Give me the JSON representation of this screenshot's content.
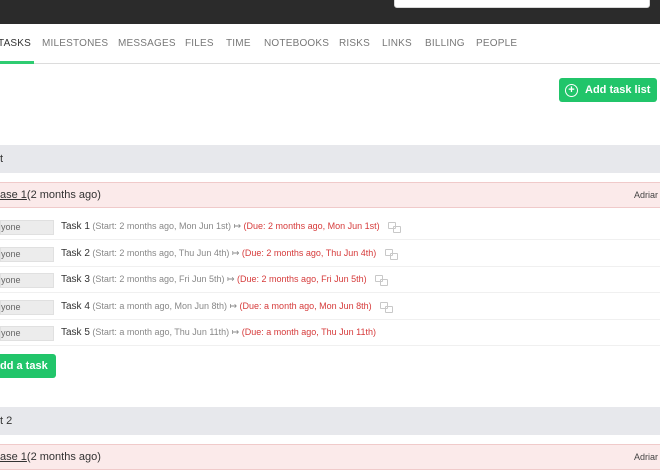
{
  "nav": {
    "tabs": [
      {
        "label": "TASKS"
      },
      {
        "label": "MILESTONES"
      },
      {
        "label": "MESSAGES"
      },
      {
        "label": "FILES"
      },
      {
        "label": "TIME"
      },
      {
        "label": "NOTEBOOKS"
      },
      {
        "label": "RISKS"
      },
      {
        "label": "LINKS"
      },
      {
        "label": "BILLING"
      },
      {
        "label": "PEOPLE"
      }
    ],
    "active_tab": "TASKS"
  },
  "actions": {
    "add_task_list": "Add task list",
    "add_task": "dd a task"
  },
  "task_lists": [
    {
      "title": "t",
      "milestone": {
        "name": "ase 1",
        "age": " (2 months ago)",
        "owner": "Adriar"
      },
      "tasks": [
        {
          "assignee": "yone",
          "name": "Task 1",
          "start": "(Start: 2 months ago, Mon Jun 1st)",
          "arrow": " ↦ ",
          "due": "(Due: 2 months ago, Mon Jun 1st)"
        },
        {
          "assignee": "yone",
          "name": "Task 2",
          "start": "(Start: 2 months ago, Thu Jun 4th)",
          "arrow": " ↦ ",
          "due": "(Due: 2 months ago, Thu Jun 4th)"
        },
        {
          "assignee": "yone",
          "name": "Task 3",
          "start": "(Start: 2 months ago, Fri Jun 5th)",
          "arrow": " ↦ ",
          "due": "(Due: 2 months ago, Fri Jun 5th)"
        },
        {
          "assignee": "yone",
          "name": "Task 4",
          "start": "(Start: a month ago, Mon Jun 8th)",
          "arrow": " ↦ ",
          "due": "(Due: a month ago, Mon Jun 8th)"
        },
        {
          "assignee": "yone",
          "name": "Task 5",
          "start": "(Start: a month ago, Thu Jun 11th)",
          "arrow": " ↦ ",
          "due": "(Due: a month ago, Thu Jun 11th)"
        }
      ]
    },
    {
      "title": "t 2",
      "milestone": {
        "name": "ase 1",
        "age": " (2 months ago)",
        "owner": "Adriar"
      },
      "tasks": []
    }
  ],
  "icons": {
    "add": "plus-circle-icon",
    "comment": "comments-icon"
  },
  "colors": {
    "accent": "#21c56a",
    "due": "#d63b3b",
    "milestone_bg": "#fbeaea",
    "list_header_bg": "#e7e8ec",
    "topbar": "#2b2b2b"
  }
}
